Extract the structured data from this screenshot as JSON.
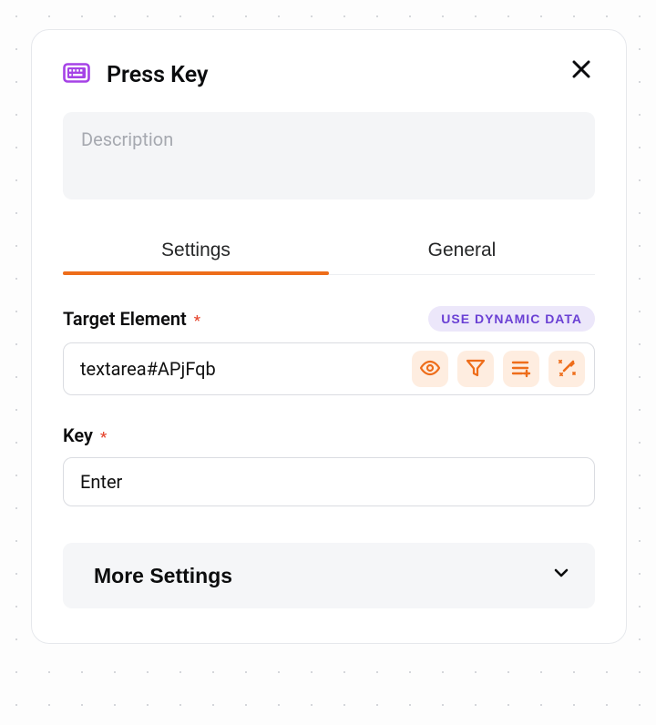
{
  "header": {
    "title": "Press Key"
  },
  "description": {
    "value": "",
    "placeholder": "Description"
  },
  "tabs": {
    "settings": "Settings",
    "general": "General",
    "active": "settings"
  },
  "target": {
    "label": "Target Element",
    "required": "*",
    "dynamic_pill": "USE DYNAMIC DATA",
    "value": "textarea#APjFqb"
  },
  "key": {
    "label": "Key",
    "required": "*",
    "value": "Enter"
  },
  "more": {
    "label": "More Settings"
  },
  "colors": {
    "accent": "#ee6d1a",
    "purple": "#a542e6",
    "pill_bg": "#ece7fa",
    "pill_text": "#6a40d4"
  },
  "icons": {
    "header_icon": "keyboard-icon",
    "close": "close-icon",
    "eye": "eye-icon",
    "funnel": "filter-icon",
    "list_plus": "list-add-icon",
    "wand": "magic-wand-icon",
    "chevron": "chevron-down-icon"
  }
}
